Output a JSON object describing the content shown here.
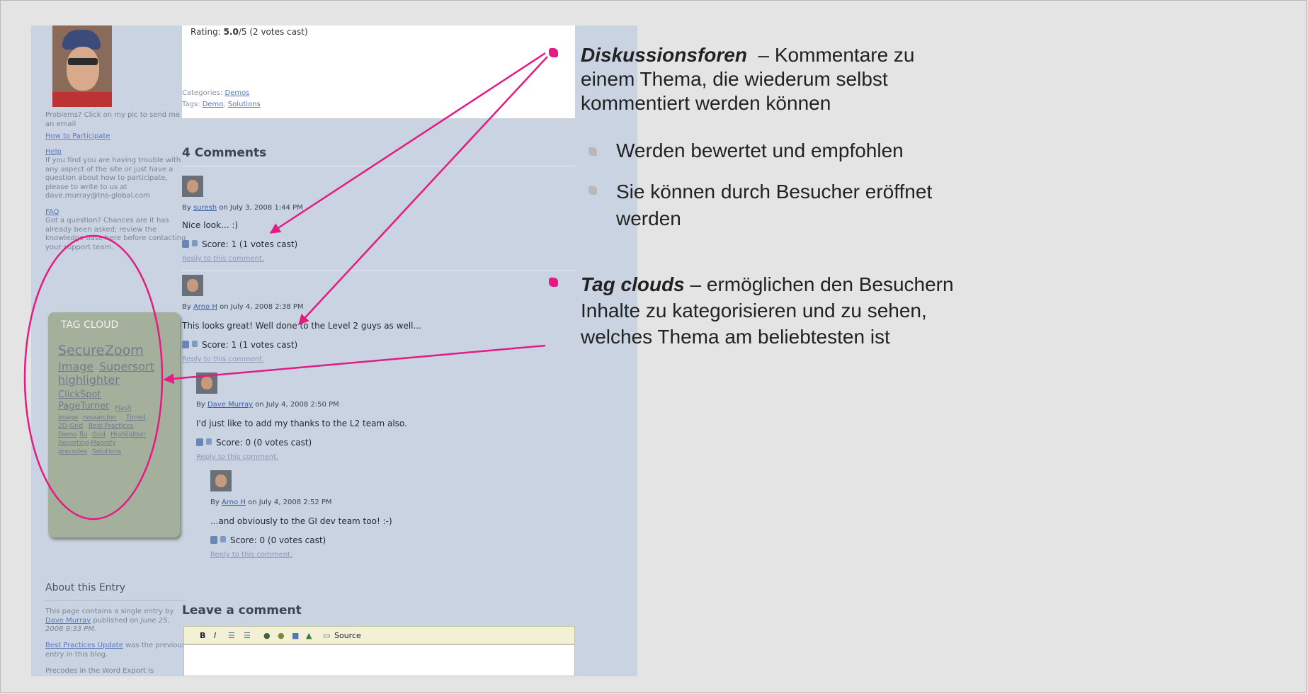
{
  "screenshot": {
    "left": {
      "help_intro": "Problems? Click on my pic to send me an email",
      "how_to": "How to Participate",
      "help": "Help",
      "help_text": "If you find you are having trouble with any aspect of the site or just have a question about how to participate, please to write to us at dave.murray@tns-global.com",
      "faq": "FAQ",
      "faq_text": "Got a question? Chances are it has already been asked; review the knowledge base here before contacting your support team.",
      "tagcloud_title": "TAG CLOUD",
      "tags": [
        "Secure",
        "Zoom",
        "Image",
        "Supersort",
        "highlighter",
        "ClickSpot",
        "PageTurner",
        "Flash",
        "image",
        "researcher",
        "Timed",
        "2D-Grid",
        "Best Practices",
        "Demo",
        "flu",
        "Grid",
        "Highlighter",
        "Reporting",
        "Magnify",
        "precodes",
        "Solutions"
      ],
      "about_title": "About this Entry",
      "about_text_1": "This page contains a single entry by",
      "about_author": "Dave Murray",
      "about_text_2": "published on",
      "about_date": "June 25, 2008 9:33 PM.",
      "prev_link": "Best Practices Update",
      "prev_text": "was the previous entry in this blog.",
      "next_text": "Precodes in the Word Export is"
    },
    "rating_label": "Rating:",
    "rating_value": "5.0",
    "rating_suffix": "/5 (2 votes cast)",
    "categories_label": "Categories:",
    "categories_value": "Demos",
    "tags_label": "Tags:",
    "tags_values": [
      "Demo",
      "Solutions"
    ],
    "comments_title": "4 Comments",
    "comments": [
      {
        "by": "By",
        "author": "suresh",
        "date": "on July 3, 2008 1:44 PM",
        "text": "Nice look... :)",
        "score": "Score: 1 (1 votes cast)",
        "reply": "Reply to this comment."
      },
      {
        "by": "By",
        "author": "Arno H",
        "date": "on July 4, 2008 2:38 PM",
        "text": "This looks great! Well done to the Level 2 guys as well...",
        "score": "Score: 1 (1 votes cast)",
        "reply": "Reply to this comment."
      },
      {
        "by": "By",
        "author": "Dave Murray",
        "date": "on July 4, 2008 2:50 PM",
        "text": "I'd just like to add my thanks to the L2 team also.",
        "score": "Score: 0 (0 votes cast)",
        "reply": "Reply to this comment."
      },
      {
        "by": "By",
        "author": "Arno H",
        "date": "on July 4, 2008 2:52 PM",
        "text": "...and obviously to the GI dev team too! :-)",
        "score": "Score: 0 (0 votes cast)",
        "reply": "Reply to this comment."
      }
    ],
    "leave_comment": "Leave a comment",
    "editor": {
      "bold": "B",
      "italic": "I",
      "source": "Source"
    }
  },
  "slide": {
    "b1_title": "Diskussionsforen",
    "b1_rest": "– Kommentare zu",
    "b1_line2": "einem Thema, die wiederum selbst",
    "b1_line3": "kommentiert werden können",
    "sub1": "Werden bewertet und empfohlen",
    "sub2_line1": "Sie können durch Besucher eröffnet",
    "sub2_line2": "werden",
    "b2_title": "Tag clouds",
    "b2_rest": "– ermöglichen den Besuchern",
    "b2_line2": "Inhalte zu kategorisieren und zu sehen,",
    "b2_line3": "welches Thema am beliebtesten ist",
    "accent_color": "#e41b82"
  }
}
